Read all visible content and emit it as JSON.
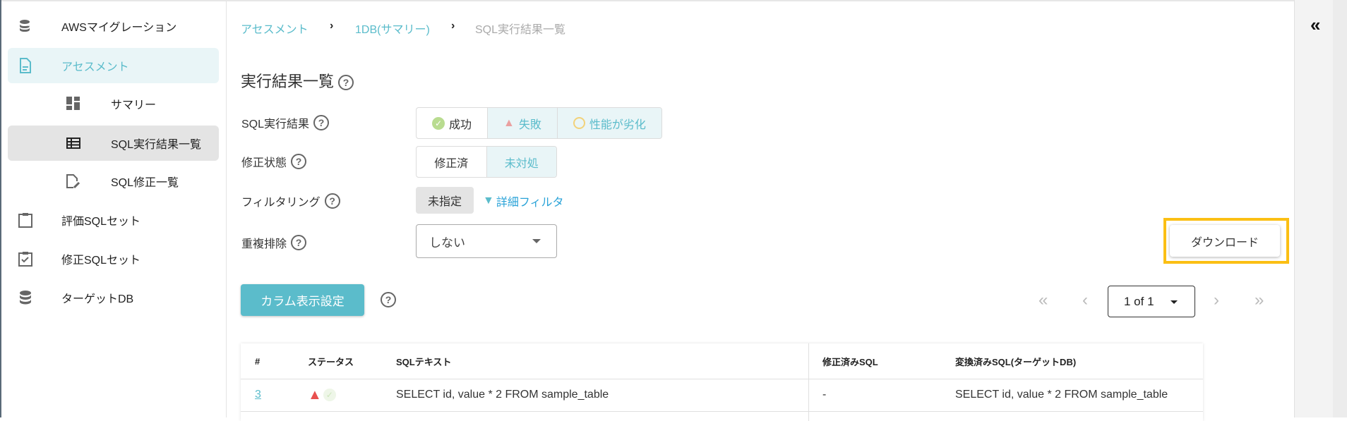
{
  "sidebar": {
    "items": [
      {
        "label": "AWSマイグレーション",
        "icon": "database-migrate-icon"
      },
      {
        "label": "アセスメント",
        "icon": "document-icon",
        "active": true
      },
      {
        "label": "サマリー",
        "icon": "dashboard-icon"
      },
      {
        "label": "SQL実行結果一覧",
        "icon": "table-list-icon",
        "selected": true
      },
      {
        "label": "SQL修正一覧",
        "icon": "edit-document-icon"
      },
      {
        "label": "評価SQLセット",
        "icon": "clipboard-icon"
      },
      {
        "label": "修正SQLセット",
        "icon": "clipboard-check-icon"
      },
      {
        "label": "ターゲットDB",
        "icon": "database-icon"
      }
    ]
  },
  "breadcrumb": [
    "アセスメント",
    "1DB(サマリー)",
    "SQL実行結果一覧"
  ],
  "title": "実行結果一覧",
  "help": "?",
  "filters": {
    "sql_result": {
      "label": "SQL実行結果",
      "options": [
        "成功",
        "失敗",
        "性能が劣化"
      ],
      "active": [
        "失敗",
        "性能が劣化"
      ]
    },
    "fix_status": {
      "label": "修正状態",
      "options": [
        "修正済",
        "未対処"
      ],
      "active": [
        "未対処"
      ]
    },
    "filtering": {
      "label": "フィルタリング",
      "value": "未指定",
      "detail_link": "詳細フィルタ"
    },
    "dedup": {
      "label": "重複排除",
      "value": "しない"
    }
  },
  "download_label": "ダウンロード",
  "column_settings_label": "カラム表示設定",
  "pagination": {
    "value": "1 of 1",
    "first": "«",
    "prev": "‹",
    "next": "›",
    "last": "»"
  },
  "table": {
    "columns": [
      "#",
      "ステータス",
      "SQLテキスト",
      "修正済みSQL",
      "変換済みSQL(ターゲットDB)"
    ],
    "rows": [
      {
        "id": "3",
        "status": [
          "failure",
          "success"
        ],
        "sql": "SELECT id, value * 2 FROM sample_table",
        "fixed_sql": "-",
        "converted_sql": "SELECT id, value * 2 FROM sample_table"
      }
    ]
  },
  "collapse_icon": "«",
  "colors": {
    "accent": "#5bbccb",
    "highlight": "#fbbf14",
    "link": "#2aa3d8",
    "error": "#e8504f"
  }
}
